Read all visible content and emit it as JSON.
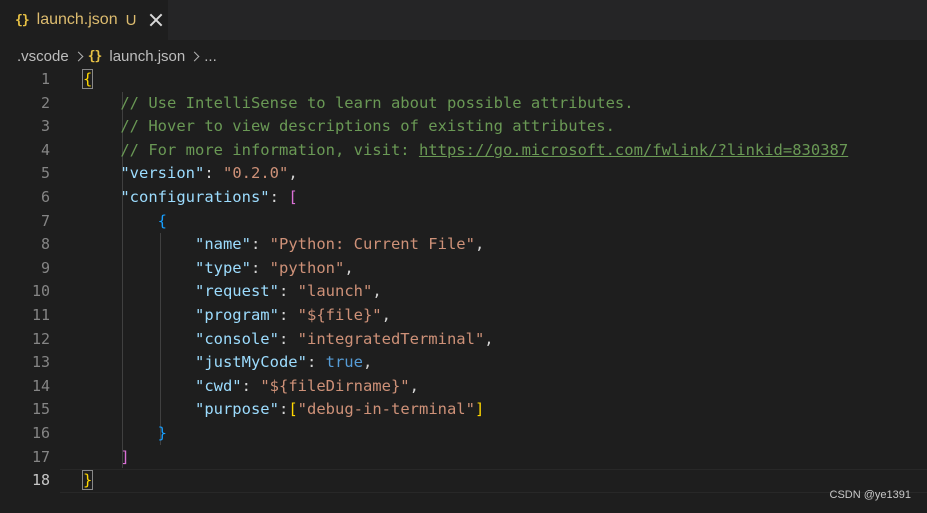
{
  "tab": {
    "icon_text": "{}",
    "icon": "json-braces-icon",
    "filename": "launch.json",
    "status": "U"
  },
  "breadcrumb": {
    "folder": ".vscode",
    "icon_text": "{}",
    "file": "launch.json",
    "more": "..."
  },
  "editor": {
    "line_numbers": [
      "1",
      "2",
      "3",
      "4",
      "5",
      "6",
      "7",
      "8",
      "9",
      "10",
      "11",
      "12",
      "13",
      "14",
      "15",
      "16",
      "17",
      "18"
    ],
    "active_line": "18",
    "lines": {
      "l1_open": "{",
      "l2_comment": "// Use IntelliSense to learn about possible attributes.",
      "l3_comment": "// Hover to view descriptions of existing attributes.",
      "l4_comment": "// For more information, visit: ",
      "l4_link": "https://go.microsoft.com/fwlink/?linkid=830387",
      "l5_key": "\"version\"",
      "l5_val": "\"0.2.0\"",
      "l6_key": "\"configurations\"",
      "l6_bracket": "[",
      "l7_open": "{",
      "l8_key": "\"name\"",
      "l8_val": "\"Python: Current File\"",
      "l9_key": "\"type\"",
      "l9_val": "\"python\"",
      "l10_key": "\"request\"",
      "l10_val": "\"launch\"",
      "l11_key": "\"program\"",
      "l11_val": "\"${file}\"",
      "l12_key": "\"console\"",
      "l12_val": "\"integratedTerminal\"",
      "l13_key": "\"justMyCode\"",
      "l13_val": "true",
      "l14_key": "\"cwd\"",
      "l14_val": "\"${fileDirname}\"",
      "l15_key": "\"purpose\"",
      "l15_open": "[",
      "l15_val": "\"debug-in-terminal\"",
      "l15_close": "]",
      "l16_close": "}",
      "l17_close": "]",
      "l18_close": "}"
    }
  },
  "watermark": "CSDN @ye1391",
  "colors": {
    "background": "#1e1e1e",
    "comment": "#6a9955",
    "key": "#9cdcfe",
    "string": "#ce9178",
    "boolean": "#569cd6",
    "bracket_level1": "#ffd700",
    "bracket_level2": "#da70d6",
    "bracket_level3": "#179fff"
  }
}
